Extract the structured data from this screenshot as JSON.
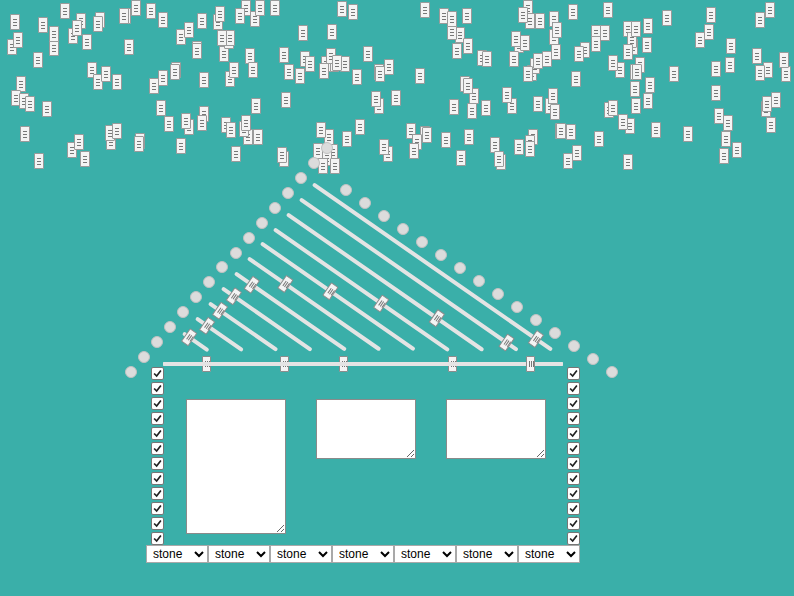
{
  "roof": {
    "left_radios": [
      {
        "checked": false
      },
      {
        "checked": false
      },
      {
        "checked": false
      },
      {
        "checked": false
      },
      {
        "checked": false
      },
      {
        "checked": false
      },
      {
        "checked": false
      },
      {
        "checked": false
      },
      {
        "checked": false
      },
      {
        "checked": false
      },
      {
        "checked": false
      },
      {
        "checked": false
      },
      {
        "checked": false
      },
      {
        "checked": false
      },
      {
        "checked": false
      },
      {
        "checked": false
      }
    ],
    "right_radios": [
      {
        "checked": false
      },
      {
        "checked": false
      },
      {
        "checked": false
      },
      {
        "checked": false
      },
      {
        "checked": false
      },
      {
        "checked": false
      },
      {
        "checked": false
      },
      {
        "checked": false
      },
      {
        "checked": false
      },
      {
        "checked": false
      },
      {
        "checked": false
      },
      {
        "checked": false
      },
      {
        "checked": false
      },
      {
        "checked": false
      },
      {
        "checked": false
      }
    ]
  },
  "rafters": [
    {
      "level": 0.95
    },
    {
      "level": 0.97
    },
    {
      "level": 0.78
    },
    {
      "level": 0.62
    },
    {
      "level": 0.45
    },
    {
      "level": 0.27
    },
    {
      "level": 0.13
    },
    {
      "level": 0.1
    },
    {
      "level": 0.12
    },
    {
      "level": 0.2
    },
    {
      "level": 0.15
    }
  ],
  "beam": [
    {
      "level": 0.1
    },
    {
      "level": 0.3
    },
    {
      "level": 0.45
    },
    {
      "level": 0.73
    },
    {
      "level": 0.93
    }
  ],
  "walls": {
    "left": [
      {
        "checked": true
      },
      {
        "checked": true
      },
      {
        "checked": true
      },
      {
        "checked": true
      },
      {
        "checked": true
      },
      {
        "checked": true
      },
      {
        "checked": true
      },
      {
        "checked": true
      },
      {
        "checked": true
      },
      {
        "checked": true
      },
      {
        "checked": true
      },
      {
        "checked": true
      }
    ],
    "right": [
      {
        "checked": true
      },
      {
        "checked": true
      },
      {
        "checked": true
      },
      {
        "checked": true
      },
      {
        "checked": true
      },
      {
        "checked": true
      },
      {
        "checked": true
      },
      {
        "checked": true
      },
      {
        "checked": true
      },
      {
        "checked": true
      },
      {
        "checked": true
      },
      {
        "checked": true
      }
    ]
  },
  "windows": [
    {
      "value": ""
    },
    {
      "value": ""
    },
    {
      "value": ""
    }
  ],
  "foundation": [
    {
      "value": "stone"
    },
    {
      "value": "stone"
    },
    {
      "value": "stone"
    },
    {
      "value": "stone"
    },
    {
      "value": "stone"
    },
    {
      "value": "stone"
    },
    {
      "value": "stone"
    }
  ]
}
